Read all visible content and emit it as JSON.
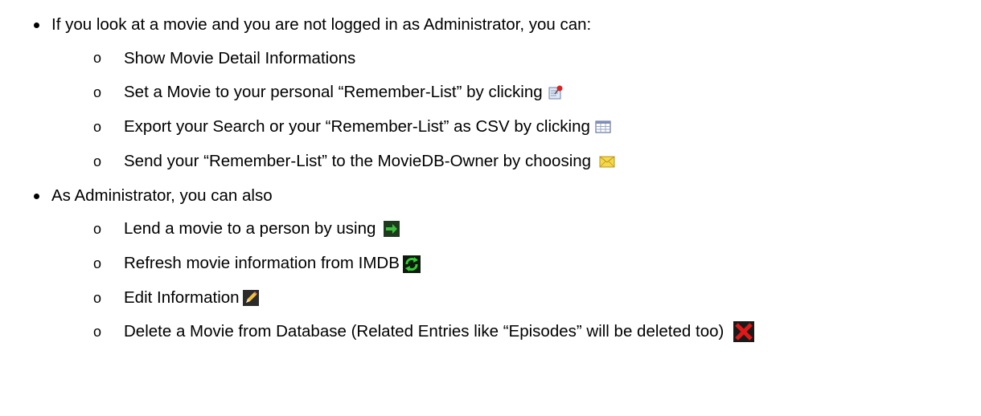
{
  "document": {
    "bullet1": {
      "text": "If you look at a movie and you are not logged in as Administrator, you can:",
      "items": [
        {
          "text": "Show Movie Detail Informations",
          "icon": null
        },
        {
          "text": "Set a Movie to your personal “Remember-List” by clicking",
          "icon": "pin-note-icon"
        },
        {
          "text": "Export your Search or your “Remember-List” as CSV by clicking",
          "icon": "table-icon"
        },
        {
          "text": "Send your “Remember-List” to the MovieDB-Owner by choosing",
          "icon": "envelope-icon"
        }
      ]
    },
    "bullet2": {
      "text": "As Administrator, you can also",
      "items": [
        {
          "text": "Lend a movie to a person by using",
          "icon": "green-arrow-icon"
        },
        {
          "text": "Refresh movie information from IMDB",
          "icon": "refresh-icon"
        },
        {
          "text": "Edit Information",
          "icon": "pencil-icon"
        },
        {
          "text": "Delete a Movie from Database (Related Entries like “Episodes” will be deleted too)",
          "icon": "delete-x-icon"
        }
      ]
    },
    "sub_bullet_glyph": "o"
  },
  "colors": {
    "text": "#000000",
    "green_arrow": "#2e8b2e",
    "refresh_green": "#33cc33",
    "delete_red": "#e01818",
    "envelope_yellow": "#f5d94a"
  }
}
